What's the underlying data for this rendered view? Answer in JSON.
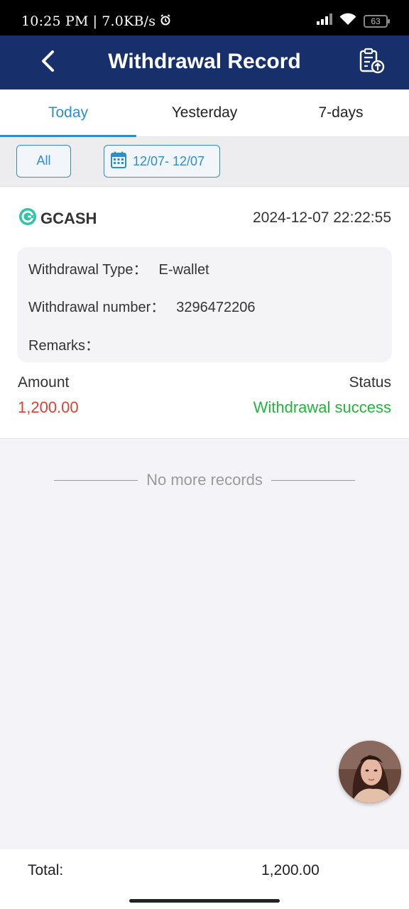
{
  "status_bar": {
    "time": "10:25 PM",
    "separator": "|",
    "network_speed": "7.0KB/s",
    "battery": "63",
    "icons": [
      "alarm-icon",
      "signal-icon",
      "wifi-icon",
      "battery-icon"
    ]
  },
  "header": {
    "title": "Withdrawal Record",
    "back_icon": "chevron-left-icon",
    "action_icon": "clipboard-upload-icon"
  },
  "tabs": [
    {
      "label": "Today",
      "active": true
    },
    {
      "label": "Yesterday",
      "active": false
    },
    {
      "label": "7-days",
      "active": false
    }
  ],
  "filters": {
    "all_label": "All",
    "date_range": "12/07- 12/07",
    "date_icon": "calendar-icon"
  },
  "record": {
    "brand": "GCASH",
    "datetime": "2024-12-07 22:22:55",
    "type_label": "Withdrawal Type：",
    "type_value": "E-wallet",
    "number_label": "Withdrawal number：",
    "number_value": "3296472206",
    "remarks_label": "Remarks：",
    "remarks_value": "",
    "amount_label": "Amount",
    "amount_value": "1,200.00",
    "status_label": "Status",
    "status_value": "Withdrawal success"
  },
  "list_end_text": "No more records",
  "footer": {
    "total_label": "Total:",
    "total_value": "1,200.00"
  },
  "colors": {
    "header_bg": "#17306b",
    "accent": "#2b8fcf",
    "amount": "#e0412f",
    "success": "#22b53b",
    "gcash_logo": "#2ec4a6"
  }
}
